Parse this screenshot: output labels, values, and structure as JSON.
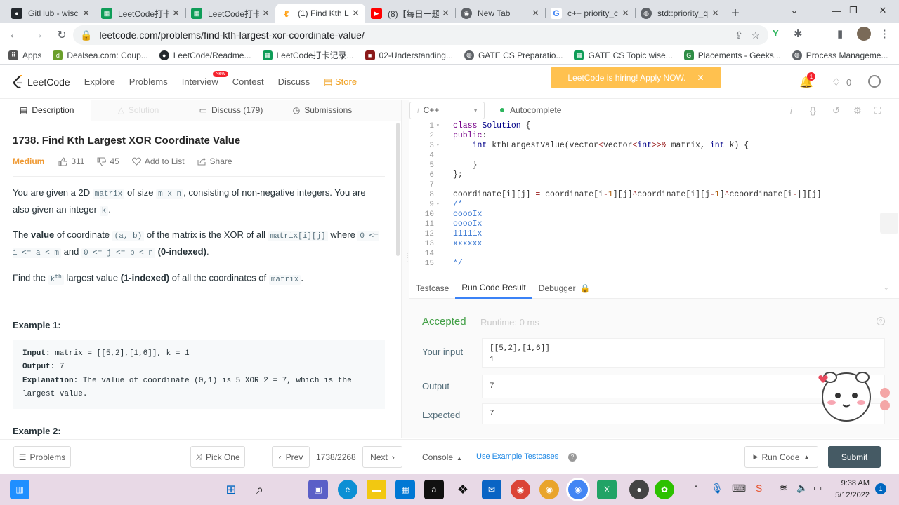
{
  "browser": {
    "tabs": [
      {
        "title": "GitHub - wisc",
        "icon": "github-icon",
        "color": "#24292e"
      },
      {
        "title": "LeetCode打卡",
        "icon": "sheet-icon",
        "color": "#0f9d58"
      },
      {
        "title": "LeetCode打卡",
        "icon": "sheet-icon",
        "color": "#0f9d58"
      },
      {
        "title": "(1) Find Kth L",
        "icon": "leetcode-icon",
        "color": "#ffa116",
        "active": true
      },
      {
        "title": "(8)【每日一题",
        "icon": "youtube-icon",
        "color": "#ff0000"
      },
      {
        "title": "New Tab",
        "icon": "chrome-icon",
        "color": "#5f6368"
      },
      {
        "title": "c++ priority_c",
        "icon": "google-icon",
        "color": "#4285f4"
      },
      {
        "title": "std::priority_q",
        "icon": "globe-icon",
        "color": "#5f6368"
      }
    ],
    "url": "leetcode.com/problems/find-kth-largest-xor-coordinate-value/",
    "bookmarks": [
      {
        "label": "Apps",
        "icon": "apps-icon",
        "color": "#555"
      },
      {
        "label": "Dealsea.com: Coup...",
        "icon": "dealsea-icon",
        "color": "#6a9f2a"
      },
      {
        "label": "LeetCode/Readme...",
        "icon": "github-icon",
        "color": "#24292e"
      },
      {
        "label": "LeetCode打卡记录...",
        "icon": "sheet-icon",
        "color": "#0f9d58"
      },
      {
        "label": "02-Understanding...",
        "icon": "bookmark-icon",
        "color": "#8b1a1a"
      },
      {
        "label": "GATE CS Preparatio...",
        "icon": "globe-icon",
        "color": "#5f6368"
      },
      {
        "label": "GATE CS Topic wise...",
        "icon": "sheet-icon",
        "color": "#0f9d58"
      },
      {
        "label": "Placements - Geeks...",
        "icon": "gfg-icon",
        "color": "#2f8d46"
      },
      {
        "label": "Process Manageme...",
        "icon": "globe-icon",
        "color": "#5f6368"
      }
    ]
  },
  "header": {
    "logo": "LeetCode",
    "nav": [
      "Explore",
      "Problems",
      "Interview",
      "Contest",
      "Discuss"
    ],
    "new_badge": "New",
    "store": "Store",
    "hiring": "LeetCode is hiring! Apply NOW.",
    "notif_count": "1",
    "coins": "0"
  },
  "left_tabs": [
    "Description",
    "Solution",
    "Discuss (179)",
    "Submissions"
  ],
  "problem": {
    "title": "1738. Find Kth Largest XOR Coordinate Value",
    "difficulty": "Medium",
    "likes": "311",
    "dislikes": "45",
    "add_to_list": "Add to List",
    "share": "Share",
    "p1a": "You are given a 2D ",
    "p1code1": "matrix",
    "p1b": " of size ",
    "p1code2": "m x n",
    "p1c": ", consisting of non-negative integers. You are also given an integer ",
    "p1code3": "k",
    "p1d": ".",
    "p2a": "The ",
    "p2bold1": "value",
    "p2b": " of coordinate ",
    "p2code1": "(a, b)",
    "p2c": " of the matrix is the XOR of all ",
    "p2code2": "matrix[i][j]",
    "p2d": " where ",
    "p2code3": "0 <= i <= a < m",
    "p2e": " and ",
    "p2code4": "0 <= j <= b < n",
    "p2f": " ",
    "p2bold2": "(0-indexed)",
    "p2g": ".",
    "p3a": "Find the ",
    "p3code1": "k",
    "p3sup": "th",
    "p3b": " largest value ",
    "p3bold": "(1-indexed)",
    "p3c": " of all the coordinates of ",
    "p3code2": "matrix",
    "p3d": ".",
    "example1_title": "Example 1:",
    "ex1_input_label": "Input:",
    "ex1_input": " matrix = [[5,2],[1,6]], k = 1",
    "ex1_output_label": "Output:",
    "ex1_output": " 7",
    "ex1_expl_label": "Explanation:",
    "ex1_expl": " The value of coordinate (0,1) is 5 XOR 2 = 7, which is the largest value.",
    "example2_title": "Example 2:"
  },
  "editor": {
    "language": "C++",
    "autocomplete": "Autocomplete",
    "lines": [
      {
        "n": "1",
        "fold": "▾",
        "text": "class Solution {"
      },
      {
        "n": "2",
        "fold": "",
        "text": "public:"
      },
      {
        "n": "3",
        "fold": "▾",
        "text": "    int kthLargestValue(vector<vector<int>>& matrix, int k) {"
      },
      {
        "n": "4",
        "fold": "",
        "text": ""
      },
      {
        "n": "5",
        "fold": "",
        "text": "    }"
      },
      {
        "n": "6",
        "fold": "",
        "text": "};"
      },
      {
        "n": "7",
        "fold": "",
        "text": ""
      },
      {
        "n": "8",
        "fold": "",
        "text": "coordinate[i][j] = coordinate[i-1][j]^coordinate[i][j-1]^ccoordinate[i-|][j]"
      },
      {
        "n": "9",
        "fold": "▾",
        "text": "/*"
      },
      {
        "n": "10",
        "fold": "",
        "text": "ooooIx"
      },
      {
        "n": "11",
        "fold": "",
        "text": "ooooIx"
      },
      {
        "n": "12",
        "fold": "",
        "text": "11111x"
      },
      {
        "n": "13",
        "fold": "",
        "text": "xxxxxx"
      },
      {
        "n": "14",
        "fold": "",
        "text": ""
      },
      {
        "n": "15",
        "fold": "",
        "text": "*/"
      }
    ]
  },
  "result_tabs": [
    "Testcase",
    "Run Code Result",
    "Debugger"
  ],
  "result": {
    "status": "Accepted",
    "runtime": "Runtime: 0 ms",
    "input_label": "Your input",
    "input_line1": "[[5,2],[1,6]]",
    "input_line2": "1",
    "output_label": "Output",
    "output": "7",
    "expected_label": "Expected",
    "expected": "7"
  },
  "bottom": {
    "problems": "Problems",
    "pick_one": "Pick One",
    "prev": "Prev",
    "counter": "1738/2268",
    "next": "Next",
    "console": "Console",
    "use_example": "Use Example Testcases",
    "run_code": "Run Code",
    "submit": "Submit"
  },
  "taskbar": {
    "time": "9:38 AM",
    "date": "5/12/2022",
    "notifications": "1"
  }
}
